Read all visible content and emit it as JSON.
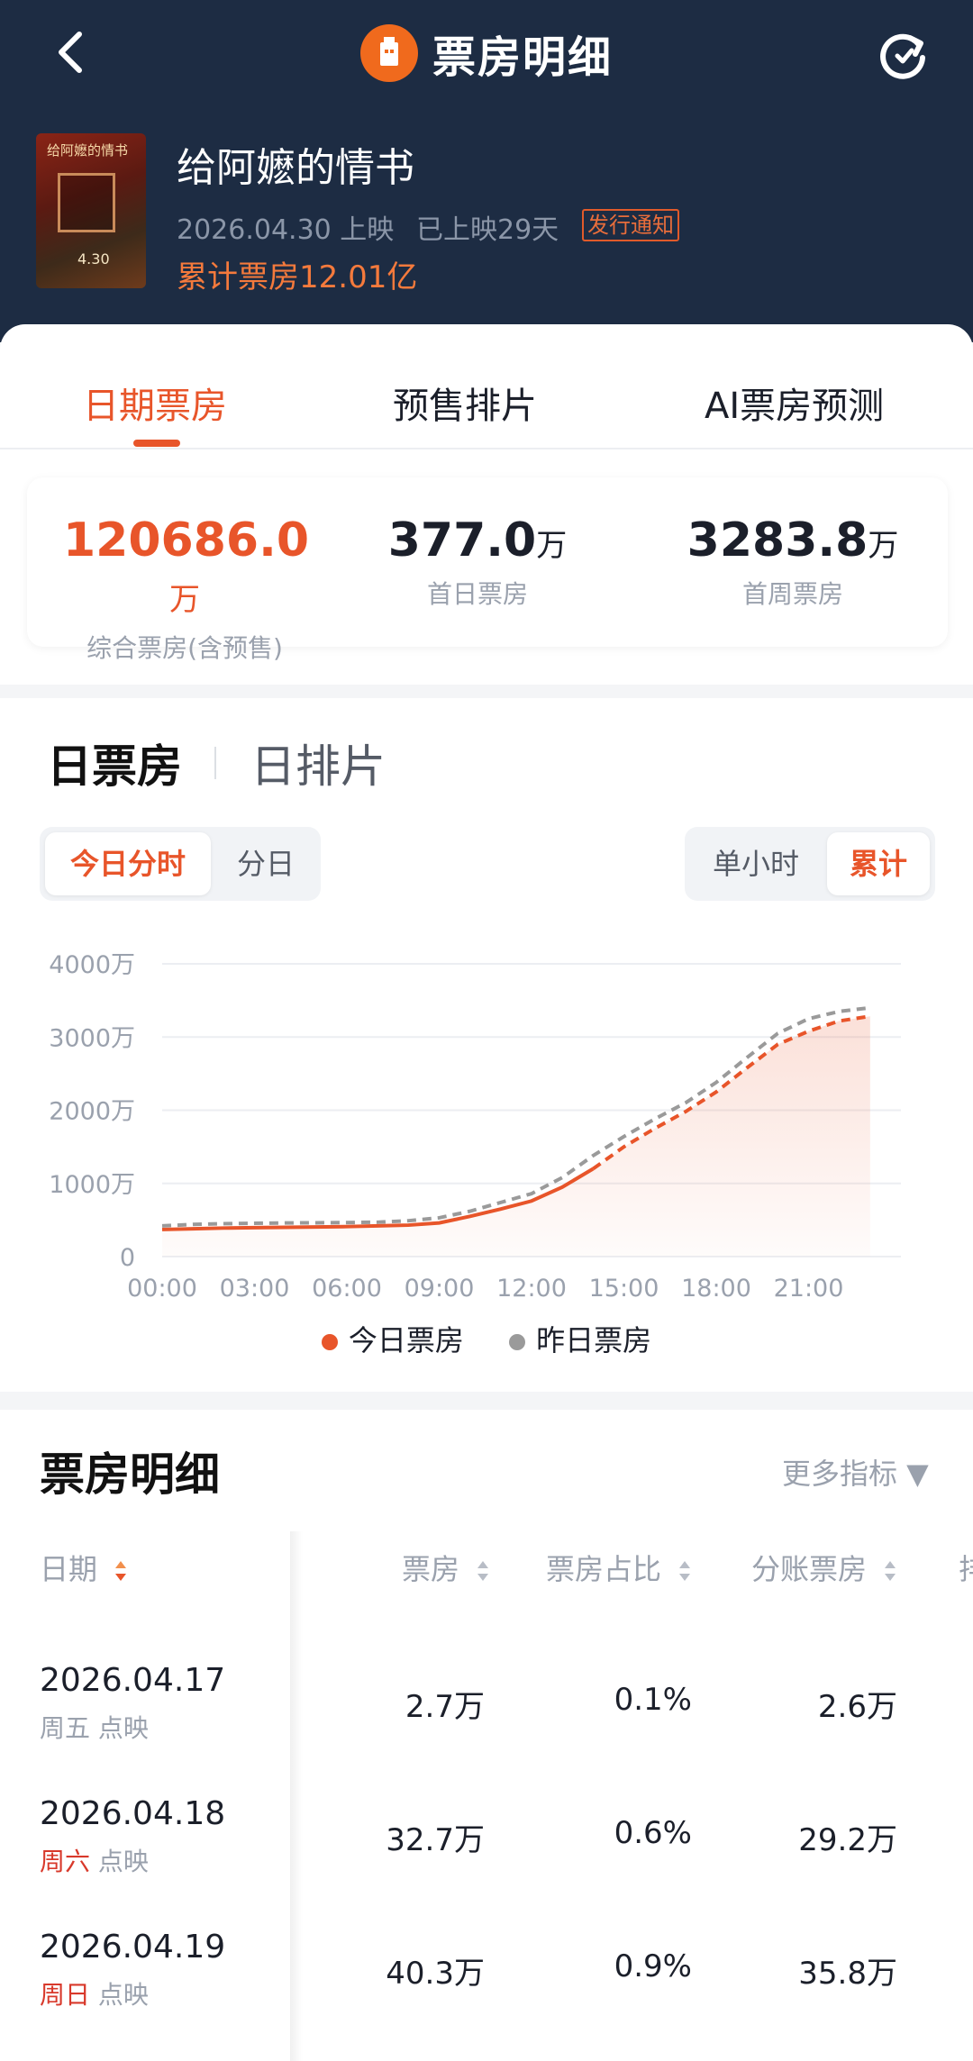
{
  "nav": {
    "title": "票房明细"
  },
  "movie": {
    "title": "给阿嬷的情书",
    "poster_text": "给阿嬷的情书",
    "poster_date": "4.30",
    "release": "2026.04.30 上映",
    "days": "已上映29天",
    "notice": "发行通知",
    "total": "累计票房12.01亿"
  },
  "tabs": [
    {
      "label": "日期票房"
    },
    {
      "label": "预售排片"
    },
    {
      "label": "AI票房预测"
    }
  ],
  "stats": [
    {
      "value": "120686.0",
      "unit": "万",
      "label": "综合票房(含预售)"
    },
    {
      "value": "377.0",
      "unit": "万",
      "label": "首日票房"
    },
    {
      "value": "3283.8",
      "unit": "万",
      "label": "首周票房"
    }
  ],
  "section_tabs": [
    {
      "label": "日票房"
    },
    {
      "label": "日排片"
    }
  ],
  "seg_left": [
    {
      "label": "今日分时"
    },
    {
      "label": "分日"
    }
  ],
  "seg_right": [
    {
      "label": "单小时"
    },
    {
      "label": "累计"
    }
  ],
  "colors": {
    "accent": "#e8552a",
    "yesterday": "#9a9a9a",
    "header_bg": "#1d2c43"
  },
  "chart_data": {
    "type": "line",
    "title": "",
    "xlabel": "",
    "ylabel": "",
    "x_ticks": [
      "00:00",
      "03:00",
      "06:00",
      "09:00",
      "12:00",
      "15:00",
      "18:00",
      "21:00"
    ],
    "y_ticks": [
      "0",
      "1000万",
      "2000万",
      "3000万",
      "4000万"
    ],
    "ylim": [
      0,
      4000
    ],
    "y_unit": "万",
    "legend_position": "bottom",
    "series": [
      {
        "name": "今日票房",
        "color": "#e8552a",
        "x": [
          0,
          1,
          2,
          3,
          4,
          5,
          6,
          7,
          8,
          9,
          10,
          11,
          12,
          13,
          14,
          15,
          16,
          17,
          18,
          19,
          20,
          21,
          22,
          23
        ],
        "values": [
          370,
          380,
          390,
          395,
          400,
          405,
          410,
          420,
          430,
          460,
          550,
          650,
          760,
          950,
          1200,
          1500,
          1750,
          1980,
          2250,
          2580,
          2900,
          3080,
          3220,
          3283.8
        ],
        "solid_until_hour": 14,
        "area_fill": true
      },
      {
        "name": "昨日票房",
        "color": "#9a9a9a",
        "x": [
          0,
          1,
          2,
          3,
          4,
          5,
          6,
          7,
          8,
          9,
          10,
          11,
          12,
          13,
          14,
          15,
          16,
          17,
          18,
          19,
          20,
          21,
          22,
          23
        ],
        "values": [
          420,
          440,
          450,
          455,
          460,
          462,
          465,
          470,
          490,
          530,
          620,
          740,
          860,
          1080,
          1380,
          1640,
          1880,
          2100,
          2380,
          2720,
          3050,
          3250,
          3350,
          3400
        ],
        "dashed": true
      }
    ]
  },
  "legend": [
    {
      "label": "今日票房",
      "color": "#e8552a"
    },
    {
      "label": "昨日票房",
      "color": "#9a9a9a"
    }
  ],
  "table": {
    "title": "票房明细",
    "more": "更多指标 ▼",
    "headers": [
      "日期",
      "票房",
      "票房占比",
      "分账票房",
      "排"
    ],
    "rows": [
      {
        "date": "2026.04.17",
        "weekday": "周五",
        "weekend": false,
        "type": "点映",
        "boxoffice": "2.7万",
        "share": "0.1%",
        "split": "2.6万"
      },
      {
        "date": "2026.04.18",
        "weekday": "周六",
        "weekend": true,
        "type": "点映",
        "boxoffice": "32.7万",
        "share": "0.6%",
        "split": "29.2万"
      },
      {
        "date": "2026.04.19",
        "weekday": "周日",
        "weekend": true,
        "type": "点映",
        "boxoffice": "40.3万",
        "share": "0.9%",
        "split": "35.8万"
      }
    ]
  }
}
